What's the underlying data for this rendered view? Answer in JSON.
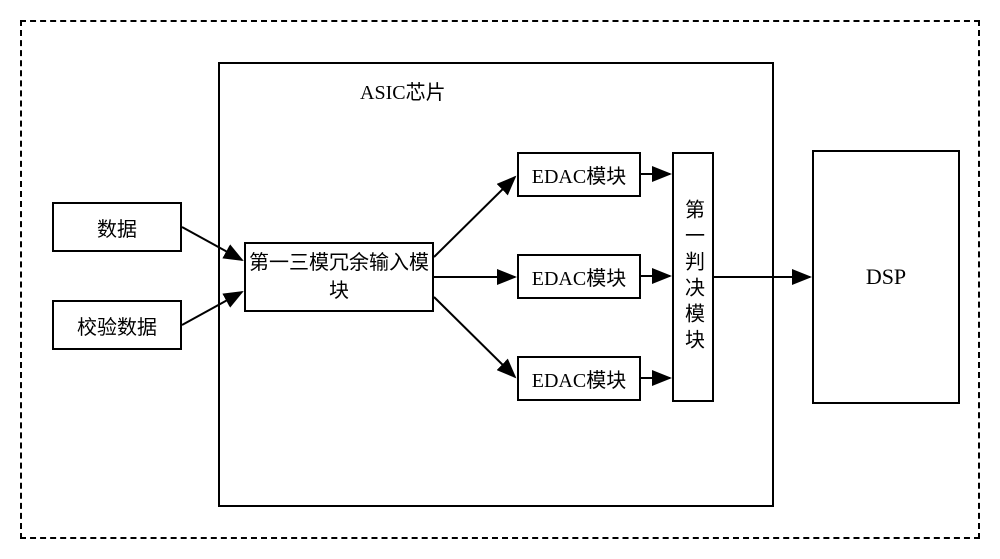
{
  "diagram": {
    "asic_title": "ASIC芯片",
    "data_label": "数据",
    "check_data_label": "校验数据",
    "tmr_input_label": "第一三模冗余输入模块",
    "edac_label": "EDAC模块",
    "decision_label": "第一判决模块",
    "dsp_label": "DSP"
  },
  "chart_data": {
    "type": "diagram",
    "title": "ASIC chip block diagram with TMR input, triple EDAC modules, decision module feeding DSP",
    "nodes": [
      {
        "id": "data",
        "label": "数据",
        "type": "input"
      },
      {
        "id": "check_data",
        "label": "校验数据",
        "type": "input"
      },
      {
        "id": "asic",
        "label": "ASIC芯片",
        "type": "container"
      },
      {
        "id": "tmr",
        "label": "第一三模冗余输入模块",
        "parent": "asic"
      },
      {
        "id": "edac1",
        "label": "EDAC模块",
        "parent": "asic"
      },
      {
        "id": "edac2",
        "label": "EDAC模块",
        "parent": "asic"
      },
      {
        "id": "edac3",
        "label": "EDAC模块",
        "parent": "asic"
      },
      {
        "id": "decision",
        "label": "第一判决模块",
        "parent": "asic"
      },
      {
        "id": "dsp",
        "label": "DSP",
        "type": "output"
      }
    ],
    "edges": [
      {
        "from": "data",
        "to": "tmr"
      },
      {
        "from": "check_data",
        "to": "tmr"
      },
      {
        "from": "tmr",
        "to": "edac1"
      },
      {
        "from": "tmr",
        "to": "edac2"
      },
      {
        "from": "tmr",
        "to": "edac3"
      },
      {
        "from": "edac1",
        "to": "decision"
      },
      {
        "from": "edac2",
        "to": "decision"
      },
      {
        "from": "edac3",
        "to": "decision"
      },
      {
        "from": "decision",
        "to": "dsp"
      }
    ]
  }
}
